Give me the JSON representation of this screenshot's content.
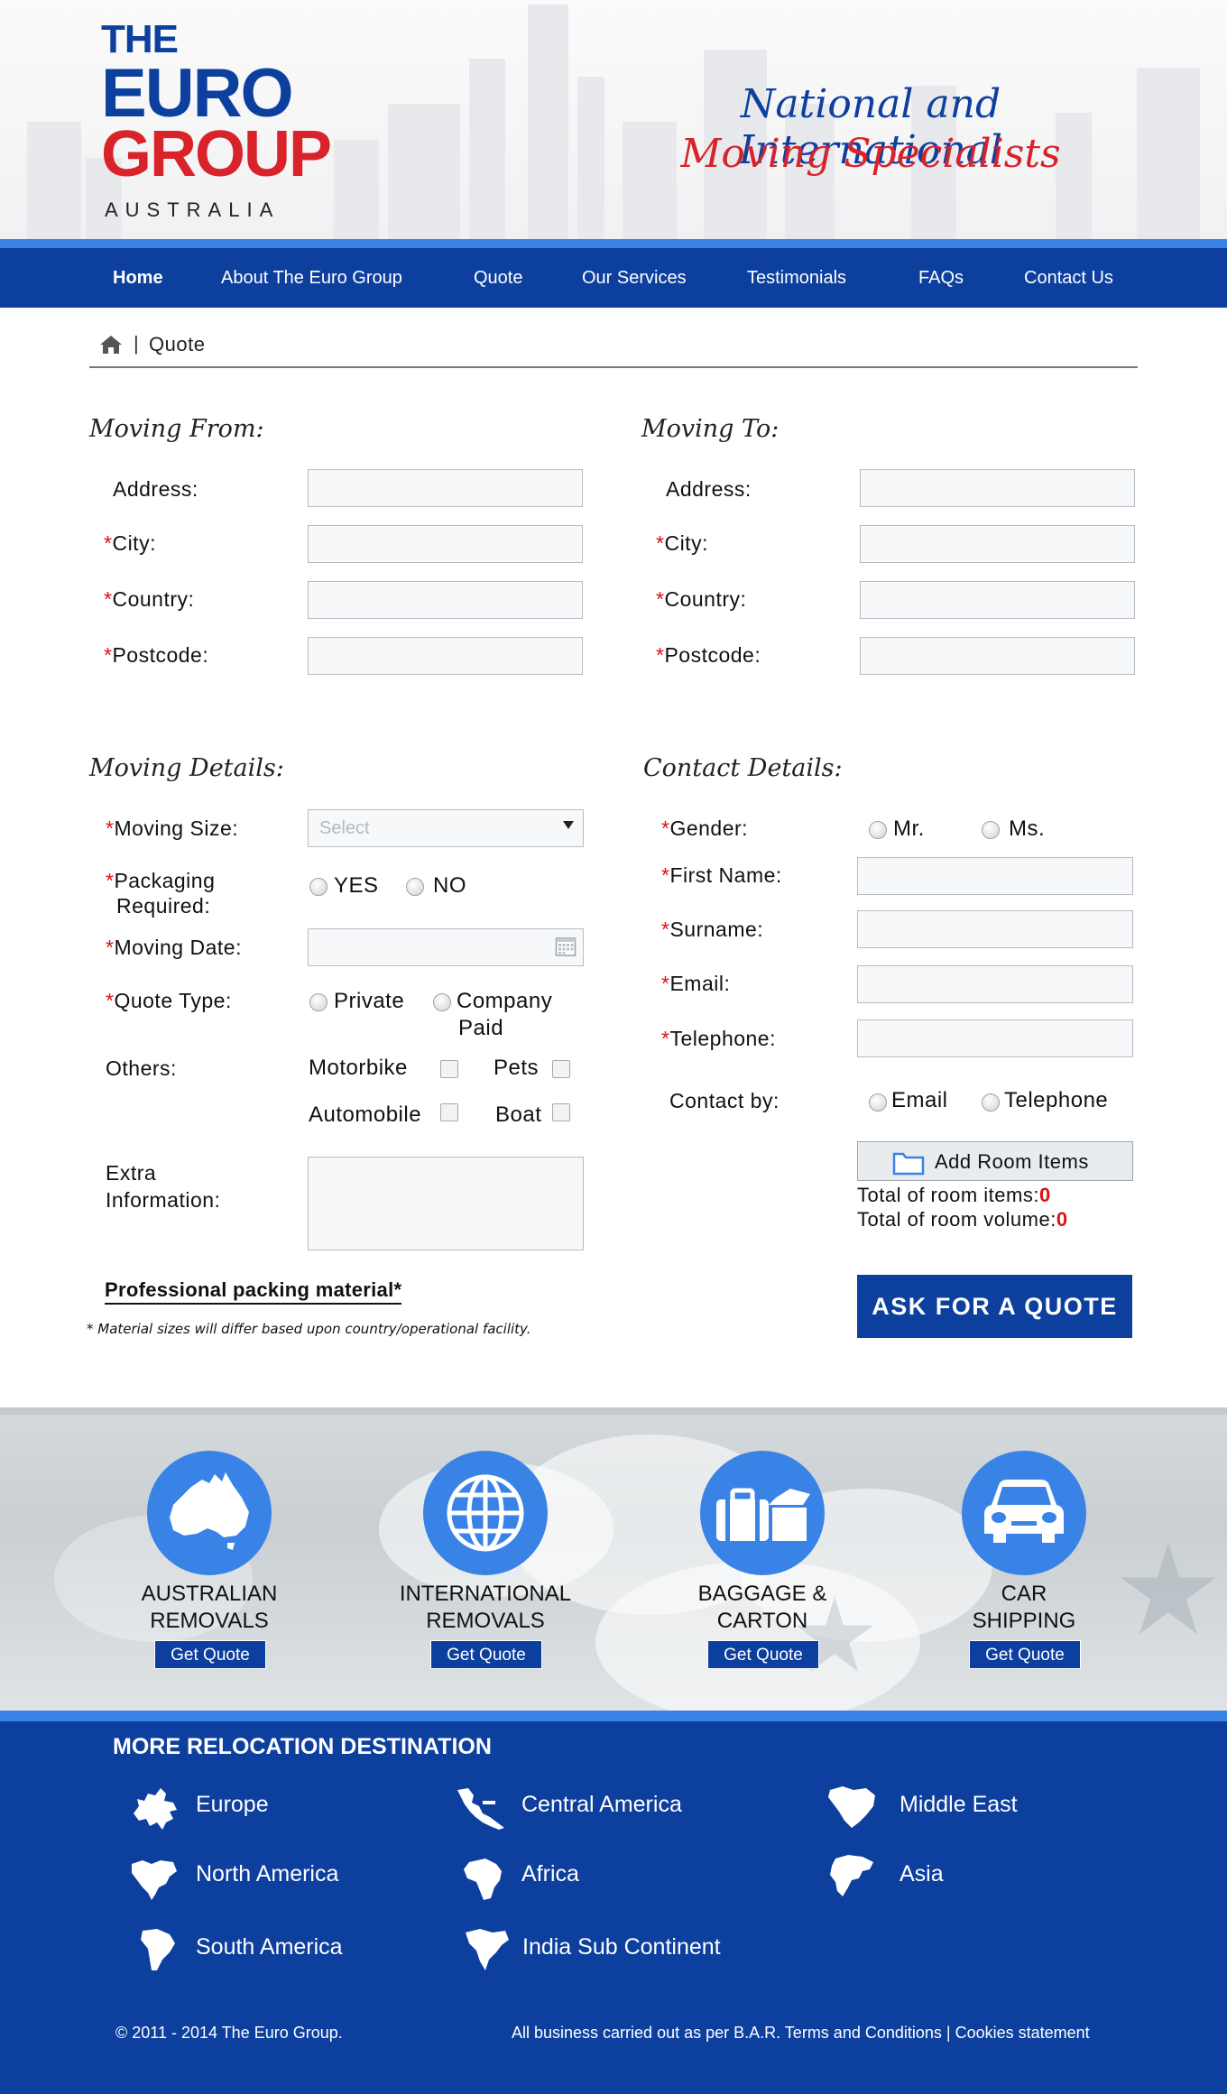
{
  "brand": {
    "logo_the": "THE",
    "logo_euro": "EURO",
    "logo_group": "GROUP",
    "logo_australia": "AUSTRALIA",
    "tagline_line1": "National and International",
    "tagline_line2": "Moving Specialists",
    "colors": {
      "navy": "#0d3f9e",
      "blue": "#3a83e6",
      "red": "#d8232a",
      "logo_blue": "#0d3f9e"
    }
  },
  "nav": {
    "items": [
      {
        "label": "Home"
      },
      {
        "label": "About The Euro Group"
      },
      {
        "label": "Quote"
      },
      {
        "label": "Our Services"
      },
      {
        "label": "Testimonials"
      },
      {
        "label": "FAQs"
      },
      {
        "label": "Contact Us"
      }
    ]
  },
  "breadcrumb": {
    "separator": "|",
    "current": "Quote",
    "home_icon": "home-icon"
  },
  "moving_from": {
    "title": "Moving From:",
    "fields": [
      {
        "label": "Address:",
        "value": ""
      },
      {
        "label": "City:",
        "value": ""
      },
      {
        "label": "Country:",
        "value": ""
      },
      {
        "label": "Postcode:",
        "value": ""
      }
    ]
  },
  "moving_to": {
    "title": "Moving To:",
    "fields": [
      {
        "label": "Address:",
        "value": ""
      },
      {
        "label": "City:",
        "value": ""
      },
      {
        "label": "Country:",
        "value": ""
      },
      {
        "label": "Postcode:",
        "value": ""
      }
    ]
  },
  "moving_details": {
    "title": "Moving Details:",
    "moving_size_label": "Moving Size:",
    "moving_size_placeholder": "Select",
    "packaging_label_1": "Packaging",
    "packaging_label_2": "Required:",
    "packaging_yes": "YES",
    "packaging_no": "NO",
    "moving_date_label": "Moving Date:",
    "moving_date_value": "",
    "quote_type_label": "Quote Type:",
    "quote_private": "Private",
    "quote_company_1": "Company",
    "quote_company_2": "Paid",
    "others_label": "Others:",
    "others": {
      "motorbike": "Motorbike",
      "pets": "Pets",
      "automobile": "Automobile",
      "boat": "Boat"
    },
    "extra_label_1": "Extra",
    "extra_label_2": "Information:",
    "extra_value": "",
    "packing_material": "Professional packing material*",
    "material_note": "* Material sizes will differ based upon country/operational facility."
  },
  "contact_details": {
    "title": "Contact Details:",
    "gender_label": "Gender:",
    "gender_mr": "Mr.",
    "gender_ms": "Ms.",
    "first_name_label": "First Name:",
    "surname_label": "Surname:",
    "email_label": "Email:",
    "telephone_label": "Telephone:",
    "contact_by_label": "Contact by:",
    "contact_email": "Email",
    "contact_telephone": "Telephone",
    "add_room_items": "Add Room Items",
    "total_items_label": "Total of room items:",
    "total_items_value": "0",
    "total_volume_label": "Total of room volume:",
    "total_volume_value": "0",
    "submit": "ASK FOR A QUOTE"
  },
  "services": [
    {
      "title_1": "AUSTRALIAN",
      "title_2": "REMOVALS",
      "button": "Get Quote",
      "icon": "australia-map-icon"
    },
    {
      "title_1": "INTERNATIONAL",
      "title_2": "REMOVALS",
      "button": "Get Quote",
      "icon": "globe-icon"
    },
    {
      "title_1": "BAGGAGE &",
      "title_2": "CARTON",
      "button": "Get Quote",
      "icon": "luggage-box-icon"
    },
    {
      "title_1": "CAR",
      "title_2": "SHIPPING",
      "button": "Get Quote",
      "icon": "car-icon"
    }
  ],
  "destinations": {
    "title": "MORE RELOCATION DESTINATION",
    "items": [
      {
        "label": "Europe",
        "icon": "europe-map-icon"
      },
      {
        "label": "Central America",
        "icon": "central-america-map-icon"
      },
      {
        "label": "Middle East",
        "icon": "middle-east-map-icon"
      },
      {
        "label": "North America",
        "icon": "north-america-map-icon"
      },
      {
        "label": "Africa",
        "icon": "africa-map-icon"
      },
      {
        "label": "Asia",
        "icon": "asia-map-icon"
      },
      {
        "label": "South America",
        "icon": "south-america-map-icon"
      },
      {
        "label": "India Sub Continent",
        "icon": "india-map-icon"
      }
    ]
  },
  "footer": {
    "copyright": "© 2011 - 2014 The Euro Group.",
    "terms": "All business carried out as per B.A.R. Terms and Conditions | Cookies statement"
  }
}
